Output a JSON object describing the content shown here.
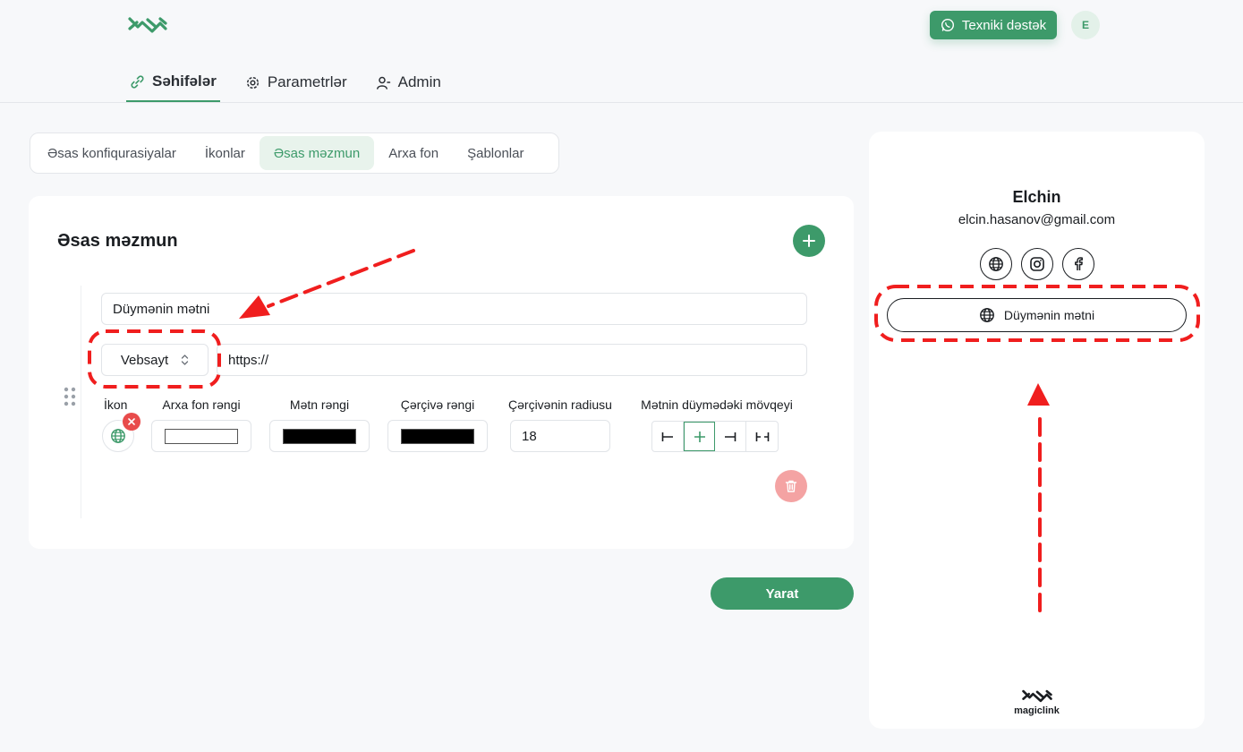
{
  "header": {
    "support_label": "Texniki dəstək",
    "support_icon": "whatsapp-icon",
    "avatar_initial": "E"
  },
  "nav": {
    "items": [
      {
        "label": "Səhifələr",
        "icon": "link-icon",
        "active": true
      },
      {
        "label": "Parametrlər",
        "icon": "gear-icon",
        "active": false
      },
      {
        "label": "Admin",
        "icon": "user-icon",
        "active": false
      }
    ]
  },
  "tabs": [
    {
      "label": "Əsas konfiqurasiyalar",
      "active": false
    },
    {
      "label": "İkonlar",
      "active": false
    },
    {
      "label": "Əsas məzmun",
      "active": true
    },
    {
      "label": "Arxa fon",
      "active": false
    },
    {
      "label": "Şablonlar",
      "active": false
    }
  ],
  "content": {
    "title": "Əsas məzmun",
    "button_text_value": "Düymənin mətni",
    "link_type_value": "Vebsayt",
    "url_value": "https://",
    "labels": {
      "icon": "İkon",
      "bg_color": "Arxa fon rəngi",
      "text_color": "Mətn rəngi",
      "border_color": "Çərçivə rəngi",
      "border_radius": "Çərçivənin radiusu",
      "text_position": "Mətnin düymədəki mövqeyi"
    },
    "colors": {
      "bg": "#ffffff",
      "text": "#000000",
      "border": "#000000"
    },
    "radius_value": "18",
    "selected_icon": "globe-icon"
  },
  "submit_label": "Yarat",
  "preview": {
    "name": "Elchin",
    "email": "elcin.hasanov@gmail.com",
    "socials": [
      "globe-icon",
      "instagram-icon",
      "facebook-icon"
    ],
    "button_label": "Düymənin mətni",
    "brand": "magiclink"
  },
  "theme": {
    "accent": "#3d9a6a",
    "danger": "#e84b4b",
    "annotation": "#f01e1e"
  }
}
